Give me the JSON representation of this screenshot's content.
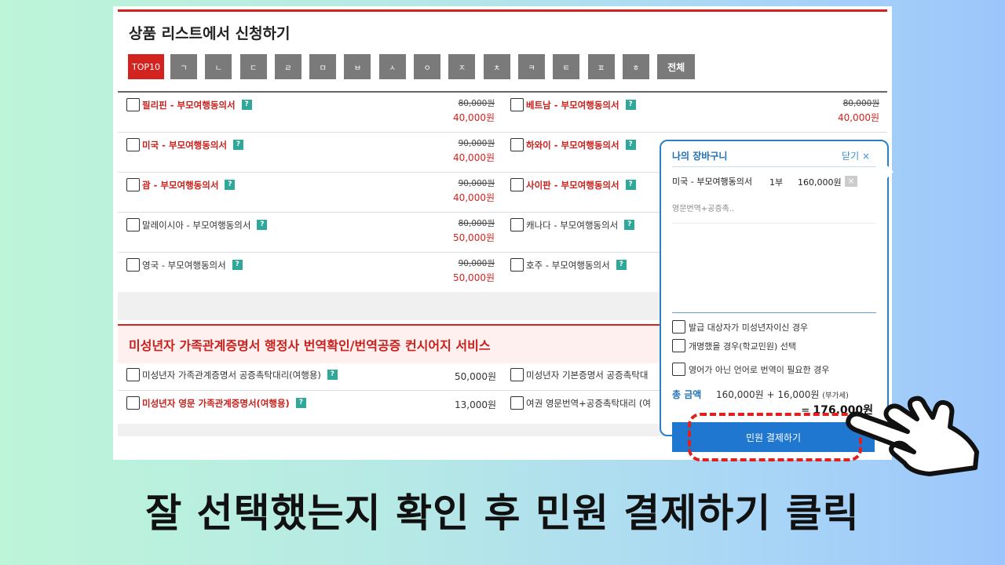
{
  "section1": {
    "title": "상품 리스트에서 신청하기",
    "index_tabs": [
      "TOP10",
      "ㄱ",
      "ㄴ",
      "ㄷ",
      "ㄹ",
      "ㅁ",
      "ㅂ",
      "ㅅ",
      "ㅇ",
      "ㅈ",
      "ㅊ",
      "ㅋ",
      "ㅌ",
      "ㅍ",
      "ㅎ",
      "전체"
    ],
    "rows": [
      {
        "left": {
          "name": "필리핀 - 부모여행동의서",
          "old": "80,000원",
          "new": "40,000원"
        },
        "right": {
          "name": "베트남 - 부모여행동의서",
          "old": "80,000원",
          "new": "40,000원"
        }
      },
      {
        "left": {
          "name": "미국 - 부모여행동의서",
          "old": "90,000원",
          "new": "40,000원"
        },
        "right": {
          "name": "하와이 - 부모여행동의서"
        }
      },
      {
        "left": {
          "name": "괌 - 부모여행동의서",
          "old": "90,000원",
          "new": "40,000원"
        },
        "right": {
          "name": "사이판 - 부모여행동의서"
        }
      },
      {
        "left": {
          "name": "말레이시아 - 부모여행동의서",
          "old": "80,000원",
          "new": "50,000원"
        },
        "right": {
          "name": "캐나다 - 부모여행동의서"
        }
      },
      {
        "left": {
          "name": "영국 - 부모여행동의서",
          "old": "90,000원",
          "new": "50,000원"
        },
        "right": {
          "name": "호주 - 부모여행동의서"
        }
      }
    ],
    "help_glyph": "?"
  },
  "section2": {
    "title": "미성년자 가족관계증명서 행정사 번역확인/번역공증 컨시어지 서비스",
    "rows": [
      {
        "left": {
          "name": "미성년자 가족관계증명서 공증촉탁대리(여행용)",
          "price": "50,000원"
        },
        "right": {
          "name": "미성년자 기본증명서 공증촉탁대"
        }
      },
      {
        "left": {
          "name": "미성년자 영문 가족관계증명서(여행용)",
          "price": "13,000원"
        },
        "right": {
          "name": "여권 영문번역+공증촉탁대리 (여"
        }
      }
    ]
  },
  "cart": {
    "title": "나의 장바구니",
    "close": "닫기 ×",
    "item": {
      "name": "미국 - 부모여행동의서",
      "qty": "1부",
      "price": "160,000원",
      "remove": "×",
      "sub": "영문번역+공증촉.."
    },
    "options": [
      "발급 대상자가 미성년자이신 경우",
      "개명했을 경우(학교민원) 선택",
      "영어가 아닌 언어로 번역이 필요한 경우"
    ],
    "total_label": "총 금액",
    "total_calc": "160,000원 + 16,000원",
    "vat_note": "(부가세)",
    "total_prefix": "=",
    "total_sum": "176,000원",
    "pay_button": "민원 결제하기"
  },
  "caption": "잘 선택했는지 확인 후 민원 결제하기 클릭",
  "colors": {
    "accent_red": "#d3231e",
    "accent_blue": "#1f77d0",
    "help_teal": "#2fa89a",
    "tab_gray": "#7a7a7a"
  }
}
